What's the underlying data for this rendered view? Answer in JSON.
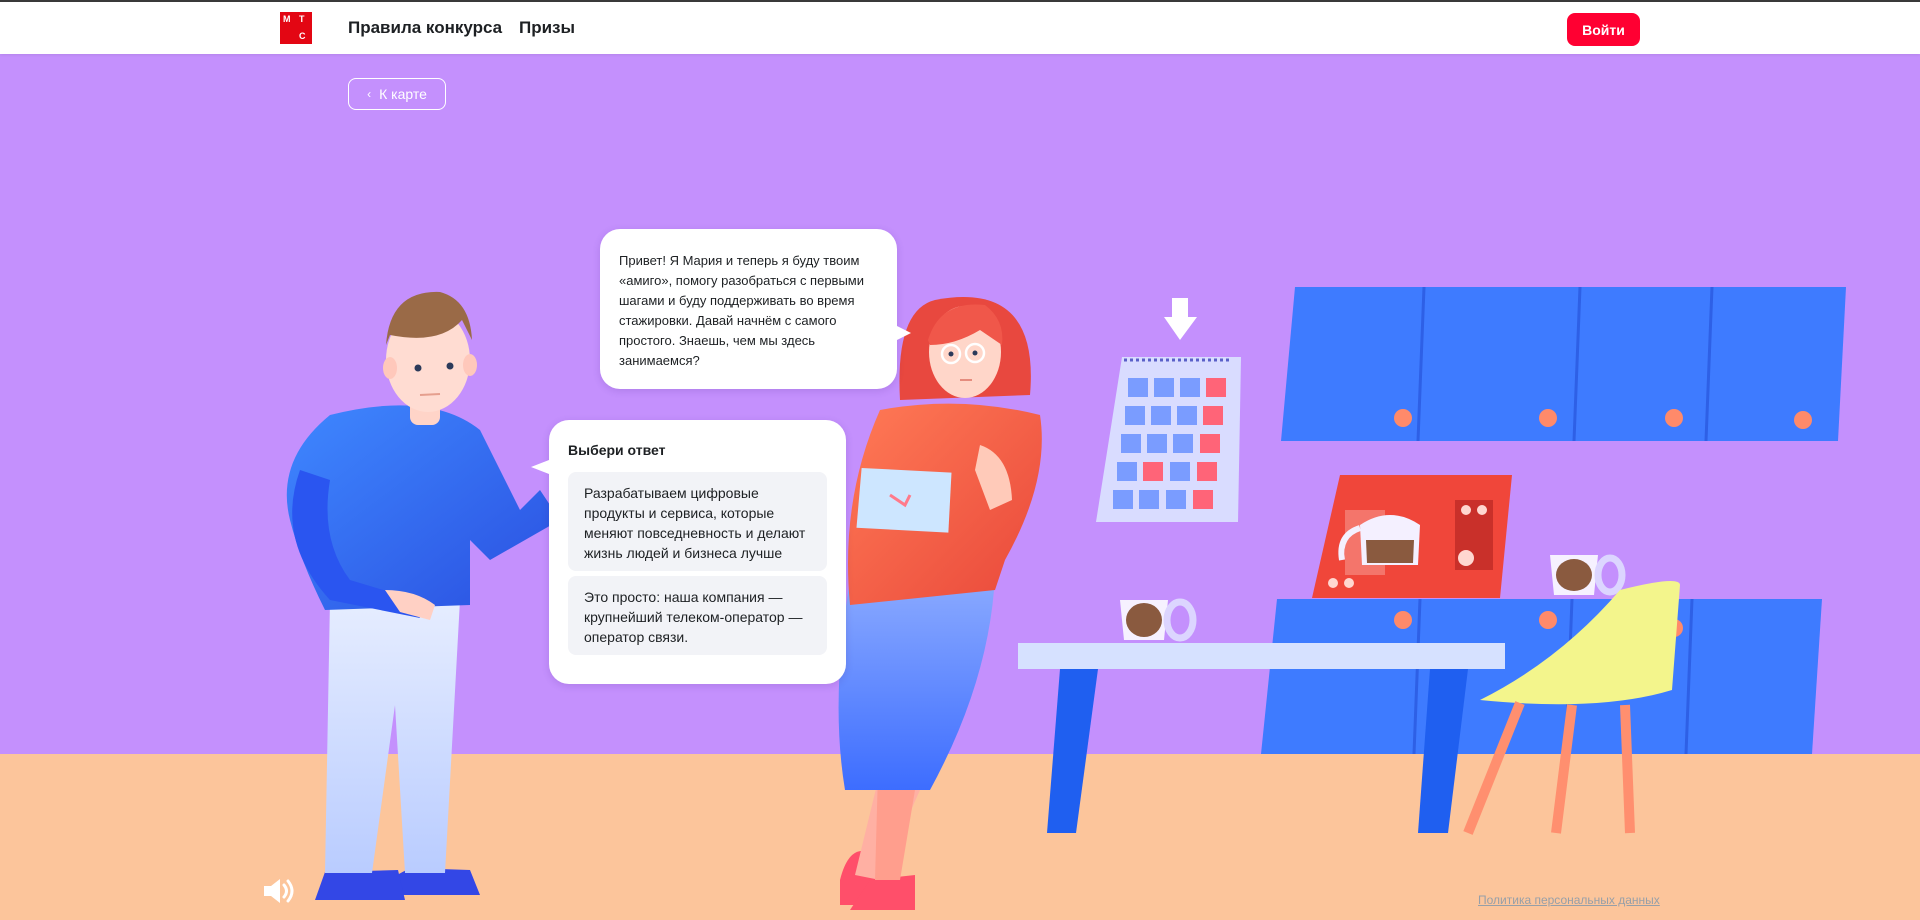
{
  "header": {
    "logo_letters": [
      "М",
      "Т",
      "С"
    ],
    "nav": [
      {
        "label": "Правила конкурса"
      },
      {
        "label": "Призы"
      }
    ],
    "login_label": "Войти"
  },
  "back_button": {
    "label": "К карте",
    "icon": "chevron-left-icon"
  },
  "dialog": {
    "speaker_text": "Привет! Я Мария и теперь я буду твоим «амиго», помогу разобраться с первыми шагами и буду поддерживать во время стажировки. Давай начнём с самого простого. Знаешь, чем мы здесь занимаемся?",
    "answers_title": "Выбери ответ",
    "answers": [
      {
        "text": "Разрабатываем цифровые продукты и сервиса, которые меняют повседневность и делают жизнь людей и бизнеса лучше"
      },
      {
        "text": "Это просто: наша компания — крупнейший телеком-оператор — оператор связи."
      }
    ]
  },
  "footer": {
    "sound_icon": "speaker-icon",
    "policy_link": "Политика персональных данных"
  },
  "colors": {
    "brand_red": "#ff0032",
    "wall": "#c490fd",
    "floor": "#fcc59b",
    "cabinet_blue": "#3e7bff"
  }
}
